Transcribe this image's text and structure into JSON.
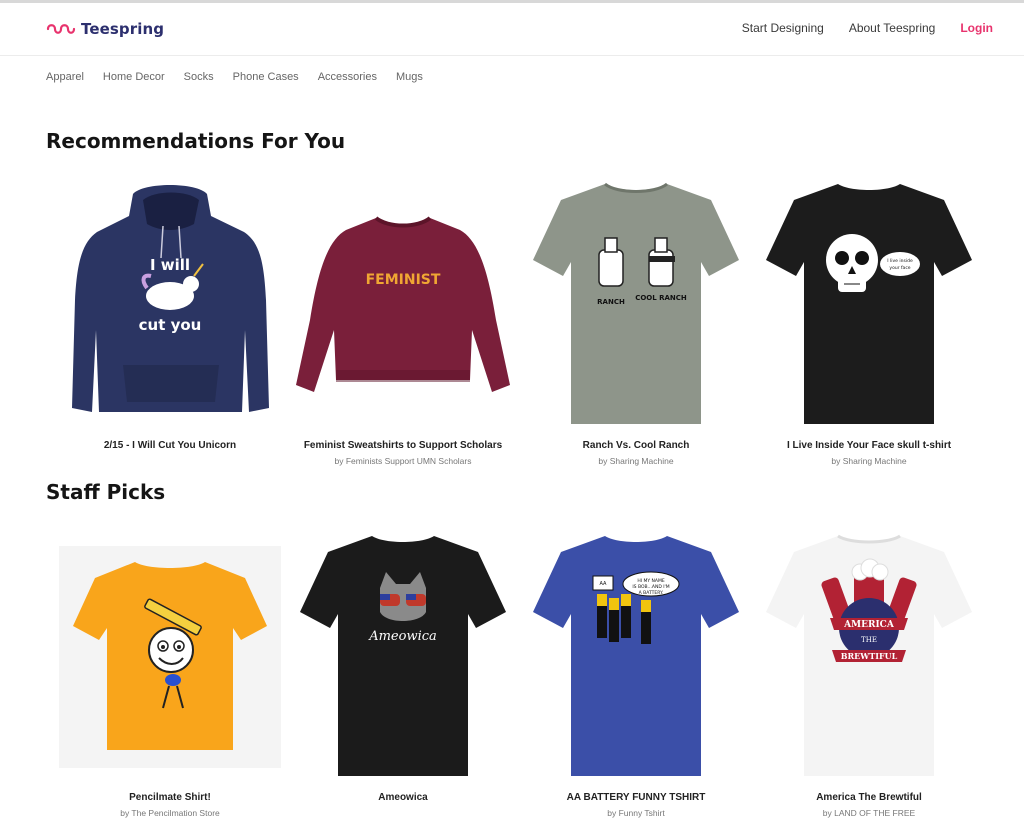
{
  "header": {
    "brand": "Teespring",
    "nav": [
      {
        "label": "Start Designing"
      },
      {
        "label": "About Teespring"
      },
      {
        "label": "Login"
      }
    ]
  },
  "categories": [
    "Apparel",
    "Home Decor",
    "Socks",
    "Phone Cases",
    "Accessories",
    "Mugs"
  ],
  "recommendations": {
    "title": "Recommendations For You",
    "items": [
      {
        "title": "2/15 - I Will Cut You Unicorn",
        "by": "",
        "color": "#2b3563",
        "print": "I will cut you"
      },
      {
        "title": "Feminist Sweatshirts to Support Scholars",
        "by": "by Feminists Support UMN Scholars",
        "color": "#7a1f3a",
        "print": "FEMINIST"
      },
      {
        "title": "Ranch Vs. Cool Ranch",
        "by": "by Sharing Machine",
        "color": "#8e958a",
        "print_left": "RANCH",
        "print_right": "COOL RANCH"
      },
      {
        "title": "I Live Inside Your Face skull t-shirt",
        "by": "by Sharing Machine",
        "color": "#1c1c1c",
        "print": "I live inside your face"
      }
    ]
  },
  "staff_picks": {
    "title": "Staff Picks",
    "items": [
      {
        "title": "Pencilmate Shirt!",
        "by": "by The Pencilmation Store",
        "color": "#f9a51b"
      },
      {
        "title": "Ameowica",
        "by": "",
        "color": "#1b1b1b",
        "print": "Ameowica"
      },
      {
        "title": "AA BATTERY FUNNY TSHIRT",
        "by": "by Funny Tshirt",
        "color": "#3b4fa8",
        "print": "HI MY NAME IS BOB...AND I'M A BATTERY."
      },
      {
        "title": "America The Brewtiful",
        "by": "by LAND OF THE FREE",
        "color": "#f4f4f4",
        "print_top": "AMERICA",
        "print_mid": "THE",
        "print_bottom": "BREWTIFUL"
      }
    ]
  },
  "colors": {
    "accent": "#e8336d",
    "brand": "#2c2f6e"
  }
}
